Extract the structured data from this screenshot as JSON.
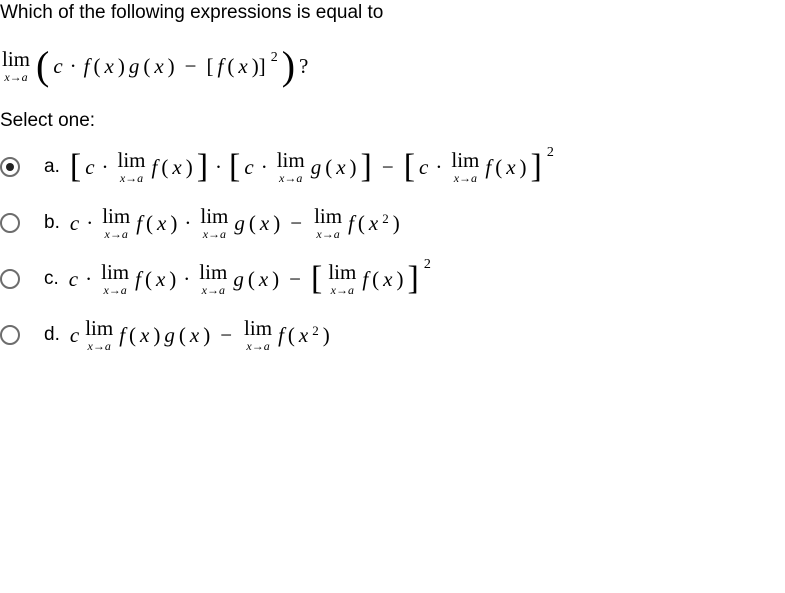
{
  "question": "Which of the following expressions is equal to",
  "main_expr": {
    "lim": "lim",
    "sub": "x→a",
    "c": "c",
    "dot": "·",
    "f": "f",
    "g": "g",
    "x": "x",
    "minus": "−",
    "q": "?",
    "sq": "2"
  },
  "select": "Select one:",
  "options": {
    "a": {
      "label": "a.",
      "c": "c",
      "dot": "·",
      "lim": "lim",
      "sub": "x→a",
      "f": "f",
      "g": "g",
      "x": "x",
      "minus": "−",
      "sq": "2"
    },
    "b": {
      "label": "b.",
      "c": "c",
      "dot": "·",
      "lim": "lim",
      "sub": "x→a",
      "f": "f",
      "g": "g",
      "x": "x",
      "minus": "−",
      "sq": "2"
    },
    "c": {
      "label": "c.",
      "c": "c",
      "dot": "·",
      "lim": "lim",
      "sub": "x→a",
      "f": "f",
      "g": "g",
      "x": "x",
      "minus": "−",
      "sq": "2"
    },
    "d": {
      "label": "d.",
      "c": "c",
      "lim": "lim",
      "sub": "x→a",
      "f": "f",
      "g": "g",
      "x": "x",
      "minus": "−",
      "sq": "2"
    }
  }
}
